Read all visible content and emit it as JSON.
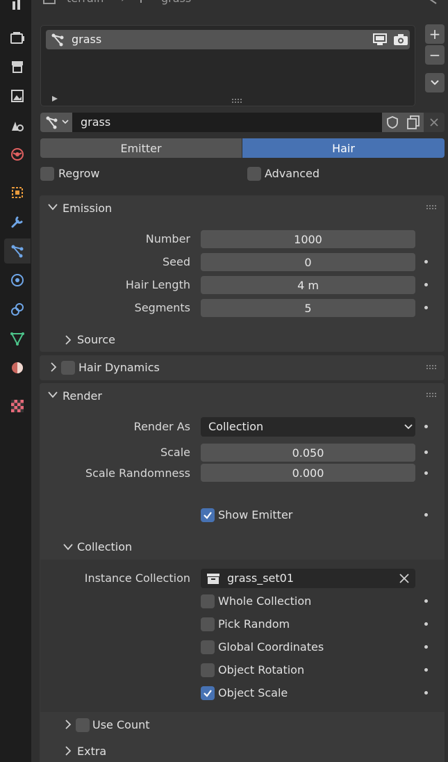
{
  "breadcrumb": {
    "object": "terrain",
    "system": "grass"
  },
  "particle_list": {
    "items": [
      {
        "label": "grass"
      }
    ]
  },
  "datablock": {
    "name": "grass"
  },
  "type_tabs": {
    "emitter": "Emitter",
    "hair": "Hair",
    "active": "Hair"
  },
  "options": {
    "regrow": "Regrow",
    "advanced": "Advanced"
  },
  "emission": {
    "title": "Emission",
    "number_label": "Number",
    "number": "1000",
    "seed_label": "Seed",
    "seed": "0",
    "hair_length_label": "Hair Length",
    "hair_length": "4 m",
    "segments_label": "Segments",
    "segments": "5",
    "source_label": "Source"
  },
  "hair_dynamics": {
    "title": "Hair Dynamics"
  },
  "render": {
    "title": "Render",
    "render_as_label": "Render As",
    "render_as": "Collection",
    "scale_label": "Scale",
    "scale": "0.050",
    "scale_rand_label": "Scale Randomness",
    "scale_rand": "0.000",
    "show_emitter": "Show Emitter"
  },
  "collection": {
    "title": "Collection",
    "instance_label": "Instance Collection",
    "instance": "grass_set01",
    "whole": "Whole Collection",
    "pick_random": "Pick Random",
    "global_coords": "Global Coordinates",
    "object_rotation": "Object Rotation",
    "object_scale": "Object Scale",
    "use_count": "Use Count"
  },
  "extra": {
    "title": "Extra"
  },
  "colors": {
    "accent": "#4772b3",
    "bg": "#303030",
    "panel": "#3a3a3a",
    "field": "#545454"
  }
}
